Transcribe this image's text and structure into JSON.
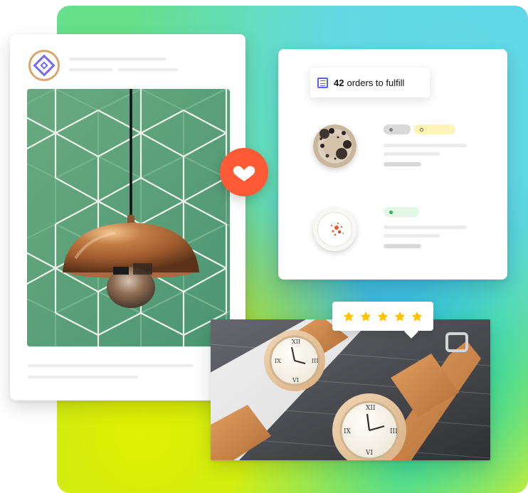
{
  "orders": {
    "count": "42",
    "label": "orders to fulfill"
  },
  "rating": {
    "stars": 5
  },
  "colors": {
    "accent_red": "#ff5a36",
    "accent_blue": "#5b5fff",
    "yellow_pill": "#fff4b8",
    "green_pill": "#e3f7e7",
    "gray_pill": "#d9d9d9"
  },
  "icons": {
    "brand": "diamond-logo-icon",
    "favorite": "heart-icon",
    "orders": "orders-icon",
    "rating": "star-icon"
  }
}
